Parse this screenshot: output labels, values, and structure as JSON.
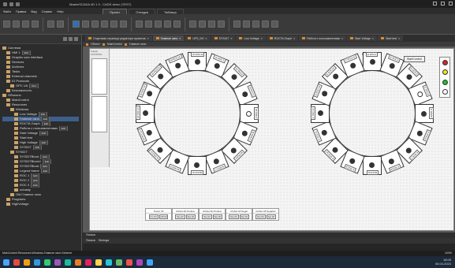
{
  "window": {
    "title": "MasterSCADA 4D 1.3 - CADS demo (TEST)"
  },
  "menu": [
    "Файл",
    "Правка",
    "Вид",
    "Сервис",
    "Help"
  ],
  "ribbon_tabs": [
    {
      "label": "Проект",
      "active": true
    },
    {
      "label": "Отладка",
      "active": false
    },
    {
      "label": "Таблица",
      "active": false
    }
  ],
  "tree": {
    "sections": [
      {
        "label": "Система",
        "indent": 0,
        "sel": false
      },
      {
        "label": "HMI 1",
        "indent": 1,
        "tag": "Edit",
        "sel": false
      },
      {
        "label": "Graphic user interface",
        "indent": 1,
        "sel": false
      },
      {
        "label": "Services",
        "indent": 1,
        "sel": false
      },
      {
        "label": "Archives",
        "indent": 1,
        "sel": false
      },
      {
        "label": "Tasks",
        "indent": 1,
        "sel": false
      },
      {
        "label": "External channels",
        "indent": 1,
        "sel": false
      },
      {
        "label": "IO Protocols",
        "indent": 1,
        "sel": false
      },
      {
        "label": "OPC UA",
        "indent": 2,
        "tag": "Run",
        "sel": false
      },
      {
        "label": "Безопасность",
        "indent": 1,
        "sel": false
      },
      {
        "label": "Объекты",
        "indent": 0,
        "sel": false
      },
      {
        "label": "MainControl",
        "indent": 1,
        "sel": false
      },
      {
        "label": "Resources",
        "indent": 1,
        "sel": false
      },
      {
        "label": "Windows",
        "indent": 2,
        "sel": false
      },
      {
        "label": "Low Voltage",
        "indent": 3,
        "tag": "Edit",
        "sel": false
      },
      {
        "label": "Главное окно",
        "indent": 3,
        "tag": "Edit",
        "sel": true
      },
      {
        "label": "ROCTA Graph",
        "indent": 3,
        "tag": "Edit",
        "sel": false
      },
      {
        "label": "Работа с пользователями",
        "indent": 3,
        "tag": "Edit",
        "sel": false
      },
      {
        "label": "Start Voltage",
        "indent": 3,
        "tag": "Edit",
        "sel": false
      },
      {
        "label": "Start test",
        "indent": 3,
        "sel": false
      },
      {
        "label": "High Voltage",
        "indent": 3,
        "tag": "Edit",
        "sel": false
      },
      {
        "label": "SYS027",
        "indent": 3,
        "tag": "Edit",
        "sel": false
      },
      {
        "label": "SYS027",
        "indent": 2,
        "sel": false
      },
      {
        "label": "SYS027Block",
        "indent": 3,
        "tag": "Edit",
        "sel": false
      },
      {
        "label": "SYS027Block4",
        "indent": 3,
        "tag": "Edit",
        "sel": false
      },
      {
        "label": "SYS027Block",
        "indent": 3,
        "tag": "Edit",
        "sel": false
      },
      {
        "label": "Legend frame",
        "indent": 3,
        "tag": "Edit",
        "sel": false
      },
      {
        "label": "ROC 1",
        "indent": 3,
        "tag": "Edit",
        "sel": false
      },
      {
        "label": "ROC 2",
        "indent": 3,
        "tag": "Edit",
        "sel": false
      },
      {
        "label": "ROC 3",
        "indent": 3,
        "tag": "Edit",
        "sel": false
      },
      {
        "label": "ochasty",
        "indent": 3,
        "sel": false
      },
      {
        "label": "Old Главное окно",
        "indent": 2,
        "sel": false
      },
      {
        "label": "Programs",
        "indent": 1,
        "sel": false
      },
      {
        "label": "HighVoltage",
        "indent": 1,
        "sel": false
      }
    ]
  },
  "doc_tabs": [
    {
      "label": "Стартовая страница редактора проектов",
      "active": false
    },
    {
      "label": "Главное окно",
      "active": true
    },
    {
      "label": "UPS_DH",
      "active": false
    },
    {
      "label": "SYS027",
      "active": false
    },
    {
      "label": "Low Voltage",
      "active": false
    },
    {
      "label": "ROCTA Graph",
      "active": false
    },
    {
      "label": "Работа с пользователями",
      "active": false
    },
    {
      "label": "Start Voltage",
      "active": false
    },
    {
      "label": "Start test",
      "active": false
    }
  ],
  "crumb": [
    "Объект",
    "MainControl",
    "Главное окно"
  ],
  "canvas": {
    "side_label": "Supply CONTROL",
    "west_label": "West Side",
    "east_label": "East Side",
    "start_button": "StartControl",
    "west_segments": [
      "W ROC11",
      "W ROC1",
      "W ROC2",
      "W ROC3",
      "W ROC4",
      "W ROC5",
      "W ROC6",
      "W ROC7",
      "ROC8 W",
      "W ROC9",
      "W ROC10",
      "W ROC12",
      "W ROC13",
      "W ROC14",
      "W ROC15",
      "W ROC16"
    ],
    "east_segments": [
      "E ROC1",
      "E ROC2",
      "E ROC3",
      "E ROC4",
      "E ROC5",
      "E ROC6",
      "E ROC7",
      "E ROC8",
      "ROC8 E",
      "E ROC9",
      "E ROC10",
      "E ROC11",
      "E ROC12",
      "E ROC13",
      "E ROC14",
      "E ROC15"
    ],
    "led_colors": [
      "#e02020",
      "#f0e020",
      "#20c020",
      "#ffffff"
    ],
    "control_table": [
      {
        "header": "Power All",
        "buttons": [
          "On All",
          "Off All"
        ]
      },
      {
        "header": "UGSet All Positive",
        "buttons": [
          "Set All",
          "Set All"
        ]
      },
      {
        "header": "UGSet All Positive",
        "buttons": [
          "Set All",
          "Set All"
        ]
      },
      {
        "header": "UGSet All Negat",
        "buttons": [
          "Set All",
          "Set All"
        ]
      },
      {
        "header": "UGSet All Negative",
        "buttons": [
          "Set All",
          "Set All"
        ]
      }
    ]
  },
  "bottom": {
    "log_label": "Поиска",
    "tabs": [
      "Поиска",
      "Легенда"
    ]
  },
  "status": {
    "path": "MainControl.Resources.Windows.Главное окно.Scheme",
    "right": "100%"
  },
  "taskbar": {
    "time": "18:05",
    "date": "06.04.2024"
  }
}
